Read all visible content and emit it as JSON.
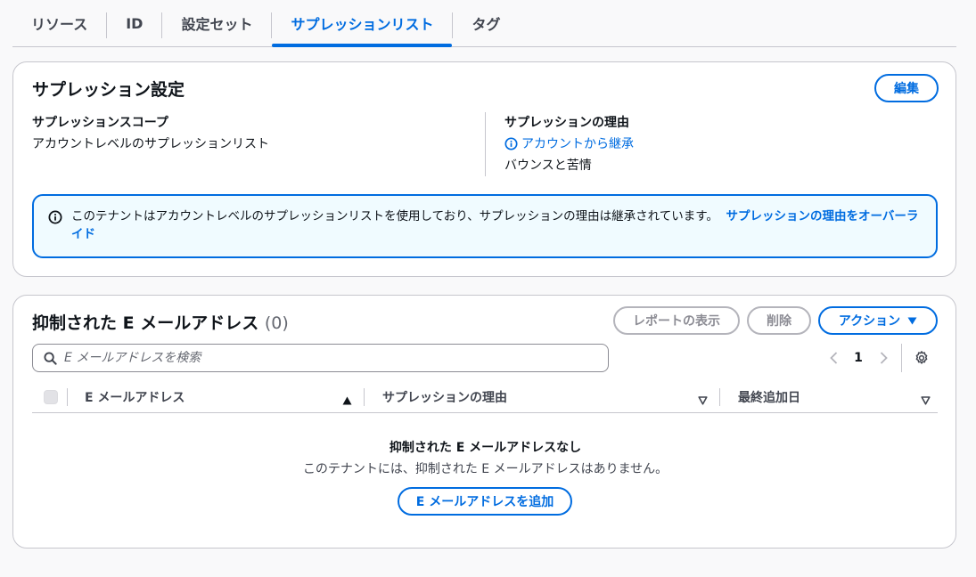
{
  "tabs": [
    {
      "label": "リソース",
      "active": false
    },
    {
      "label": "ID",
      "active": false
    },
    {
      "label": "設定セット",
      "active": false
    },
    {
      "label": "サプレッションリスト",
      "active": true
    },
    {
      "label": "タグ",
      "active": false
    }
  ],
  "suppression_settings": {
    "title": "サプレッション設定",
    "edit_label": "編集",
    "scope_label": "サプレッションスコープ",
    "scope_value": "アカウントレベルのサプレッションリスト",
    "reason_label": "サプレッションの理由",
    "reason_link": "アカウントから継承",
    "reason_value": "バウンスと苦情",
    "alert_text": "このテナントはアカウントレベルのサプレッションリストを使用しており、サプレッションの理由は継承されています。",
    "alert_link": "サプレッションの理由をオーバーライド"
  },
  "suppressed": {
    "title": "抑制された E メールアドレス",
    "count": "(0)",
    "report_label": "レポートの表示",
    "delete_label": "削除",
    "actions_label": "アクション",
    "search_placeholder": "E メールアドレスを検索",
    "page": "1",
    "columns": [
      "E メールアドレス",
      "サプレッションの理由",
      "最終追加日"
    ],
    "empty_title": "抑制された E メールアドレスなし",
    "empty_desc": "このテナントには、抑制された E メールアドレスはありません。",
    "add_label": "E メールアドレスを追加"
  },
  "colors": {
    "accent": "#006ce0",
    "alert_bg": "#f0fbff",
    "border": "#c6c6cd"
  }
}
